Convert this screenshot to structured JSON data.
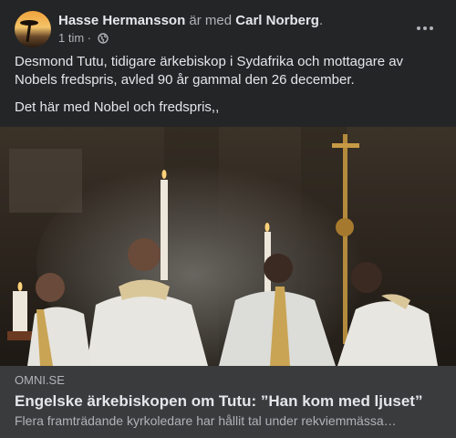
{
  "post": {
    "author": "Hasse Hermansson",
    "with_text": "är med",
    "tagged": "Carl Norberg",
    "tagged_suffix": ".",
    "time": "1 tim",
    "separator": "·",
    "privacy_icon": "globe-icon",
    "more_icon": "more-dots-icon",
    "text": [
      "Desmond Tutu, tidigare ärkebiskop i Sydafrika och mottagare av Nobels fredspris, avled 90 år gammal den 26 december.",
      "Det här med Nobel och fredspris,,"
    ]
  },
  "link_preview": {
    "domain": "OMNI.SE",
    "title": "Engelske ärkebiskopen om Tutu: ”Han kom med ljuset”",
    "description": "Flera framträdande kyrkoledare har hållit tal under rekviemmässa…"
  },
  "colors": {
    "card_bg": "#242526",
    "link_bg": "#3a3b3c",
    "text_primary": "#e4e6eb",
    "text_secondary": "#b0b3b8"
  }
}
